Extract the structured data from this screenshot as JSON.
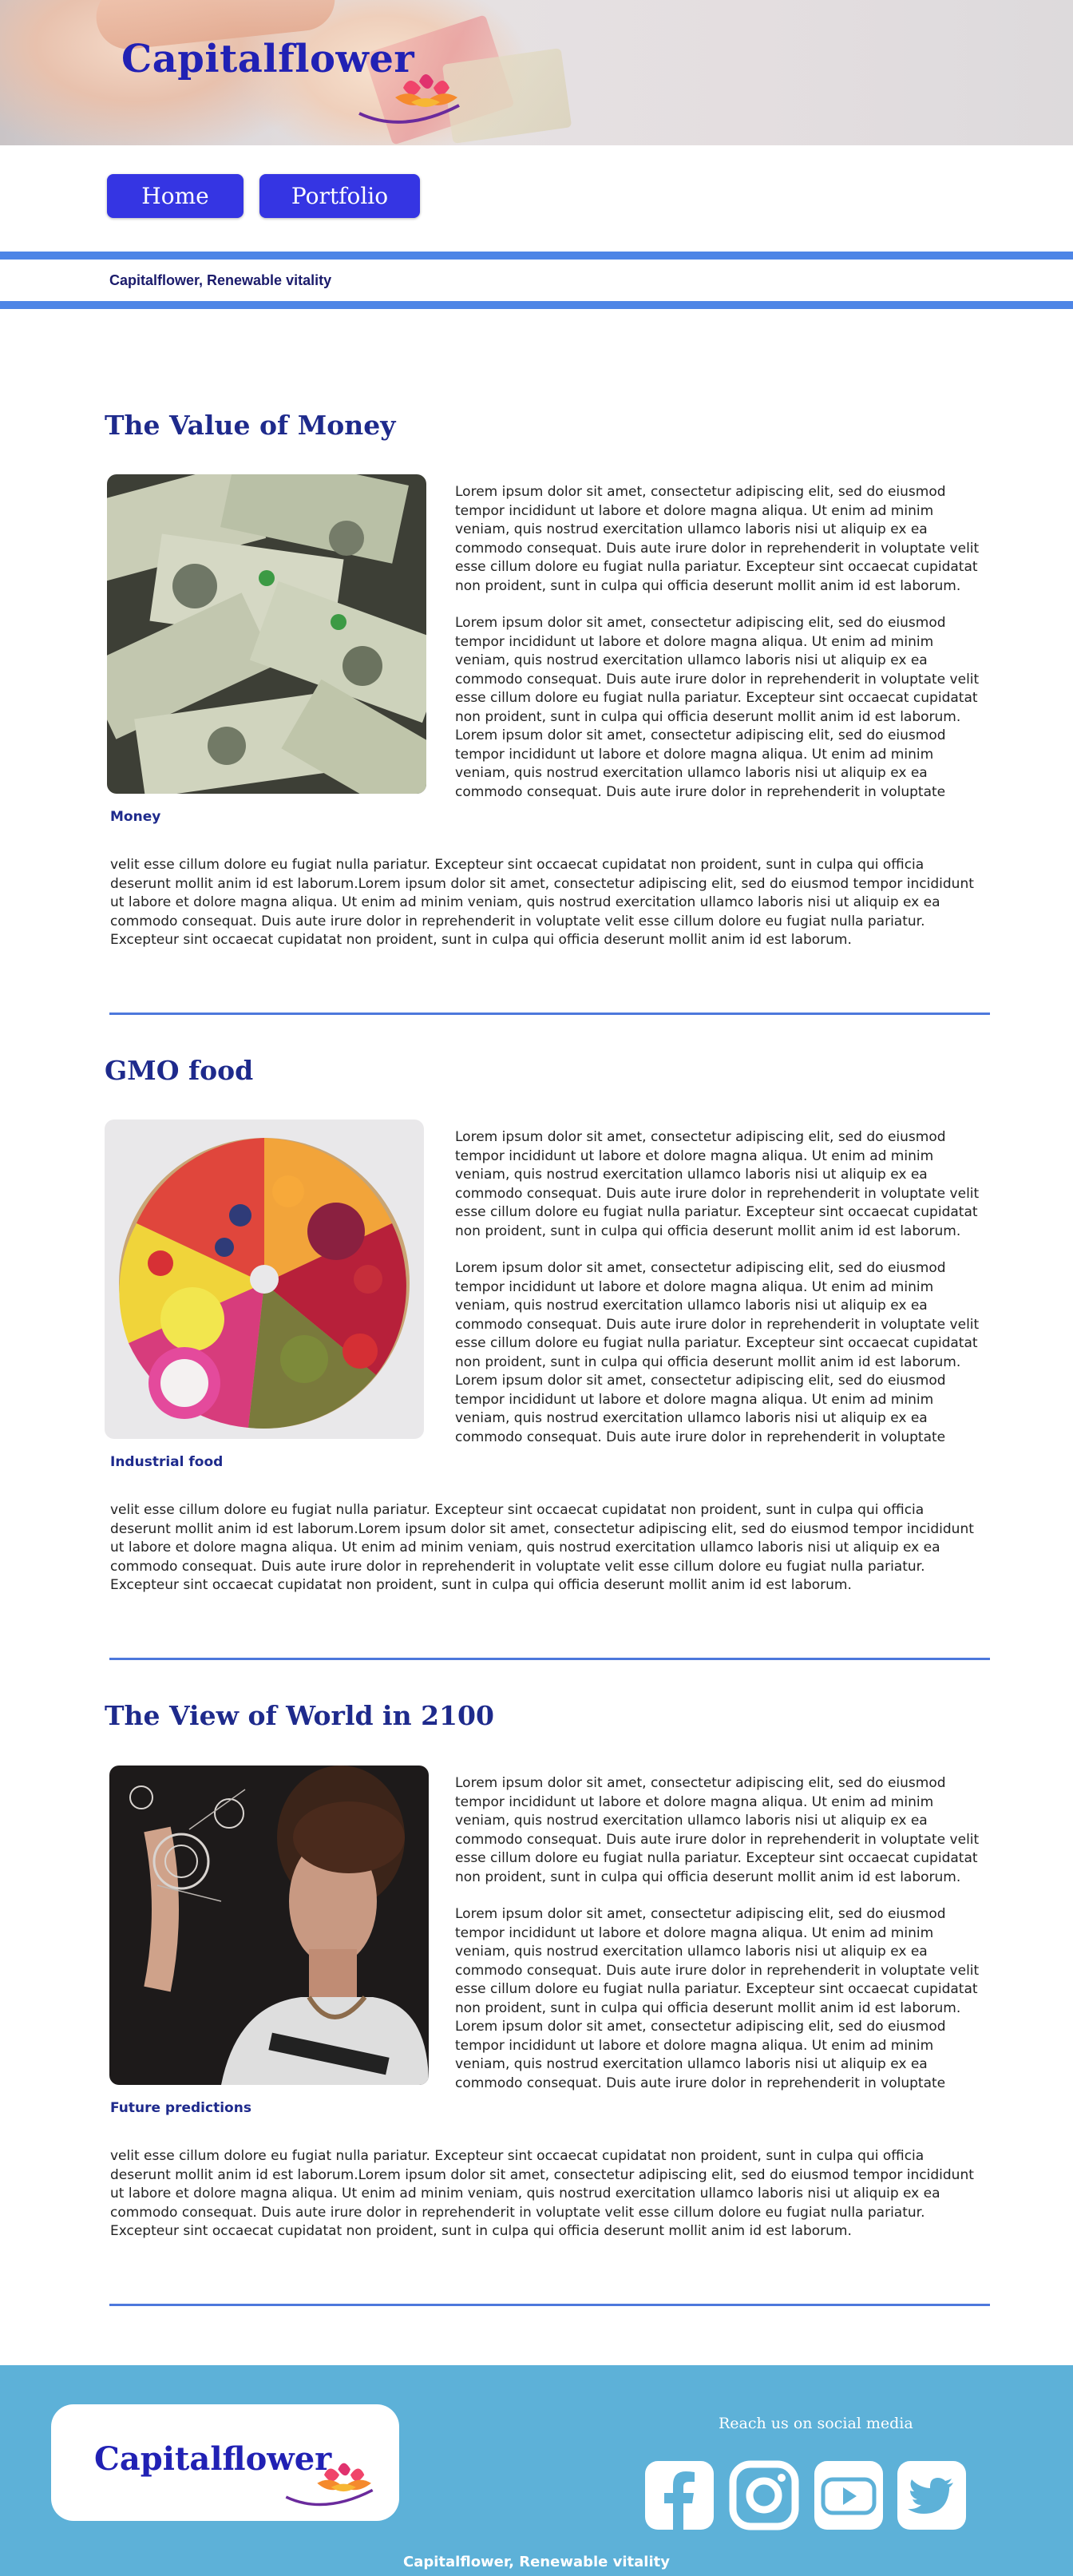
{
  "header": {
    "brand": "Capitalflower"
  },
  "nav": {
    "home": "Home",
    "portfolio": "Portfolio"
  },
  "tagline": "Capitalflower, Renewable vitality",
  "articles": [
    {
      "title": "The Value of Money",
      "caption": "Money",
      "paragraph_1": "Lorem ipsum dolor sit amet, consectetur adipiscing elit, sed do eiusmod tempor incididunt ut labore et dolore magna aliqua. Ut enim ad minim veniam, quis nostrud exercitation ullamco laboris nisi ut aliquip ex ea commodo consequat. Duis aute irure dolor in reprehenderit in voluptate velit esse cillum dolore eu fugiat nulla pariatur. Excepteur sint occaecat cupidatat non proident, sunt in culpa qui officia deserunt mollit anim id est laborum.",
      "paragraph_2": "Lorem ipsum dolor sit amet, consectetur adipiscing elit, sed do eiusmod tempor incididunt ut labore et dolore magna aliqua. Ut enim ad minim veniam, quis nostrud exercitation ullamco laboris nisi ut aliquip ex ea commodo consequat. Duis aute irure dolor in reprehenderit in voluptate velit esse cillum dolore eu fugiat nulla pariatur. Excepteur sint occaecat cupidatat non proident, sunt in culpa qui officia deserunt mollit anim id est laborum.",
      "paragraph_3_start": "Lorem ipsum dolor sit amet, consectetur adipiscing elit, sed do eiusmod tempor incididunt ut labore et dolore magna aliqua. Ut enim ad minim veniam, quis nostrud exercitation ullamco laboris nisi ut aliquip ex ea commodo consequat. Duis aute irure dolor in reprehenderit in voluptate",
      "paragraph_3_end": "velit esse cillum dolore eu fugiat nulla pariatur. Excepteur sint occaecat cupidatat non proident, sunt in culpa qui officia deserunt mollit anim id est laborum.Lorem ipsum dolor sit amet, consectetur adipiscing elit, sed do eiusmod tempor incididunt ut labore et dolore magna aliqua. Ut enim ad minim veniam, quis nostrud exercitation ullamco laboris nisi ut aliquip ex ea commodo consequat. Duis aute irure dolor in reprehenderit in voluptate velit esse cillum dolore eu fugiat nulla pariatur. Excepteur sint occaecat cupidatat non proident, sunt in culpa qui officia deserunt mollit anim id est laborum."
    },
    {
      "title": "GMO food",
      "caption": "Industrial food",
      "paragraph_1": "Lorem ipsum dolor sit amet, consectetur adipiscing elit, sed do eiusmod tempor incididunt ut labore et dolore magna aliqua. Ut enim ad minim veniam, quis nostrud exercitation ullamco laboris nisi ut aliquip ex ea commodo consequat. Duis aute irure dolor in reprehenderit in voluptate velit esse cillum dolore eu fugiat nulla pariatur. Excepteur sint occaecat cupidatat non proident, sunt in culpa qui officia deserunt mollit anim id est laborum.",
      "paragraph_2": "Lorem ipsum dolor sit amet, consectetur adipiscing elit, sed do eiusmod tempor incididunt ut labore et dolore magna aliqua. Ut enim ad minim veniam, quis nostrud exercitation ullamco laboris nisi ut aliquip ex ea commodo consequat. Duis aute irure dolor in reprehenderit in voluptate velit esse cillum dolore eu fugiat nulla pariatur. Excepteur sint occaecat cupidatat non proident, sunt in culpa qui officia deserunt mollit anim id est laborum.",
      "paragraph_3_start": "Lorem ipsum dolor sit amet, consectetur adipiscing elit, sed do eiusmod tempor incididunt ut labore et dolore magna aliqua. Ut enim ad minim veniam, quis nostrud exercitation ullamco laboris nisi ut aliquip ex ea commodo consequat. Duis aute irure dolor in reprehenderit in voluptate",
      "paragraph_3_end": "velit esse cillum dolore eu fugiat nulla pariatur. Excepteur sint occaecat cupidatat non proident, sunt in culpa qui officia deserunt mollit anim id est laborum.Lorem ipsum dolor sit amet, consectetur adipiscing elit, sed do eiusmod tempor incididunt ut labore et dolore magna aliqua. Ut enim ad minim veniam, quis nostrud exercitation ullamco laboris nisi ut aliquip ex ea commodo consequat. Duis aute irure dolor in reprehenderit in voluptate velit esse cillum dolore eu fugiat nulla pariatur. Excepteur sint occaecat cupidatat non proident, sunt in culpa qui officia deserunt mollit anim id est laborum."
    },
    {
      "title": "The View of World in 2100",
      "caption": "Future predictions",
      "paragraph_1": "Lorem ipsum dolor sit amet, consectetur adipiscing elit, sed do eiusmod tempor incididunt ut labore et dolore magna aliqua. Ut enim ad minim veniam, quis nostrud exercitation ullamco laboris nisi ut aliquip ex ea commodo consequat. Duis aute irure dolor in reprehenderit in voluptate velit esse cillum dolore eu fugiat nulla pariatur. Excepteur sint occaecat cupidatat non proident, sunt in culpa qui officia deserunt mollit anim id est laborum.",
      "paragraph_2": "Lorem ipsum dolor sit amet, consectetur adipiscing elit, sed do eiusmod tempor incididunt ut labore et dolore magna aliqua. Ut enim ad minim veniam, quis nostrud exercitation ullamco laboris nisi ut aliquip ex ea commodo consequat. Duis aute irure dolor in reprehenderit in voluptate velit esse cillum dolore eu fugiat nulla pariatur. Excepteur sint occaecat cupidatat non proident, sunt in culpa qui officia deserunt mollit anim id est laborum.",
      "paragraph_3_start": "Lorem ipsum dolor sit amet, consectetur adipiscing elit, sed do eiusmod tempor incididunt ut labore et dolore magna aliqua. Ut enim ad minim veniam, quis nostrud exercitation ullamco laboris nisi ut aliquip ex ea commodo consequat. Duis aute irure dolor in reprehenderit in voluptate",
      "paragraph_3_end": "velit esse cillum dolore eu fugiat nulla pariatur. Excepteur sint occaecat cupidatat non proident, sunt in culpa qui officia deserunt mollit anim id est laborum.Lorem ipsum dolor sit amet, consectetur adipiscing elit, sed do eiusmod tempor incididunt ut labore et dolore magna aliqua. Ut enim ad minim veniam, quis nostrud exercitation ullamco laboris nisi ut aliquip ex ea commodo consequat. Duis aute irure dolor in reprehenderit in voluptate velit esse cillum dolore eu fugiat nulla pariatur. Excepteur sint occaecat cupidatat non proident, sunt in culpa qui officia deserunt mollit anim id est laborum."
    }
  ],
  "footer": {
    "brand": "Capitalflower",
    "social_label": "Reach us on social media",
    "social_icons": [
      "facebook-icon",
      "instagram-icon",
      "youtube-icon",
      "twitter-icon"
    ],
    "tagline": "Capitalflower, Renewable vitality"
  },
  "colors": {
    "brand_blue": "#2121b4",
    "nav_button": "#3535e3",
    "accent_line": "#4d85e6",
    "footer_bg": "#5db1d8",
    "heading": "#1e2a8c"
  }
}
